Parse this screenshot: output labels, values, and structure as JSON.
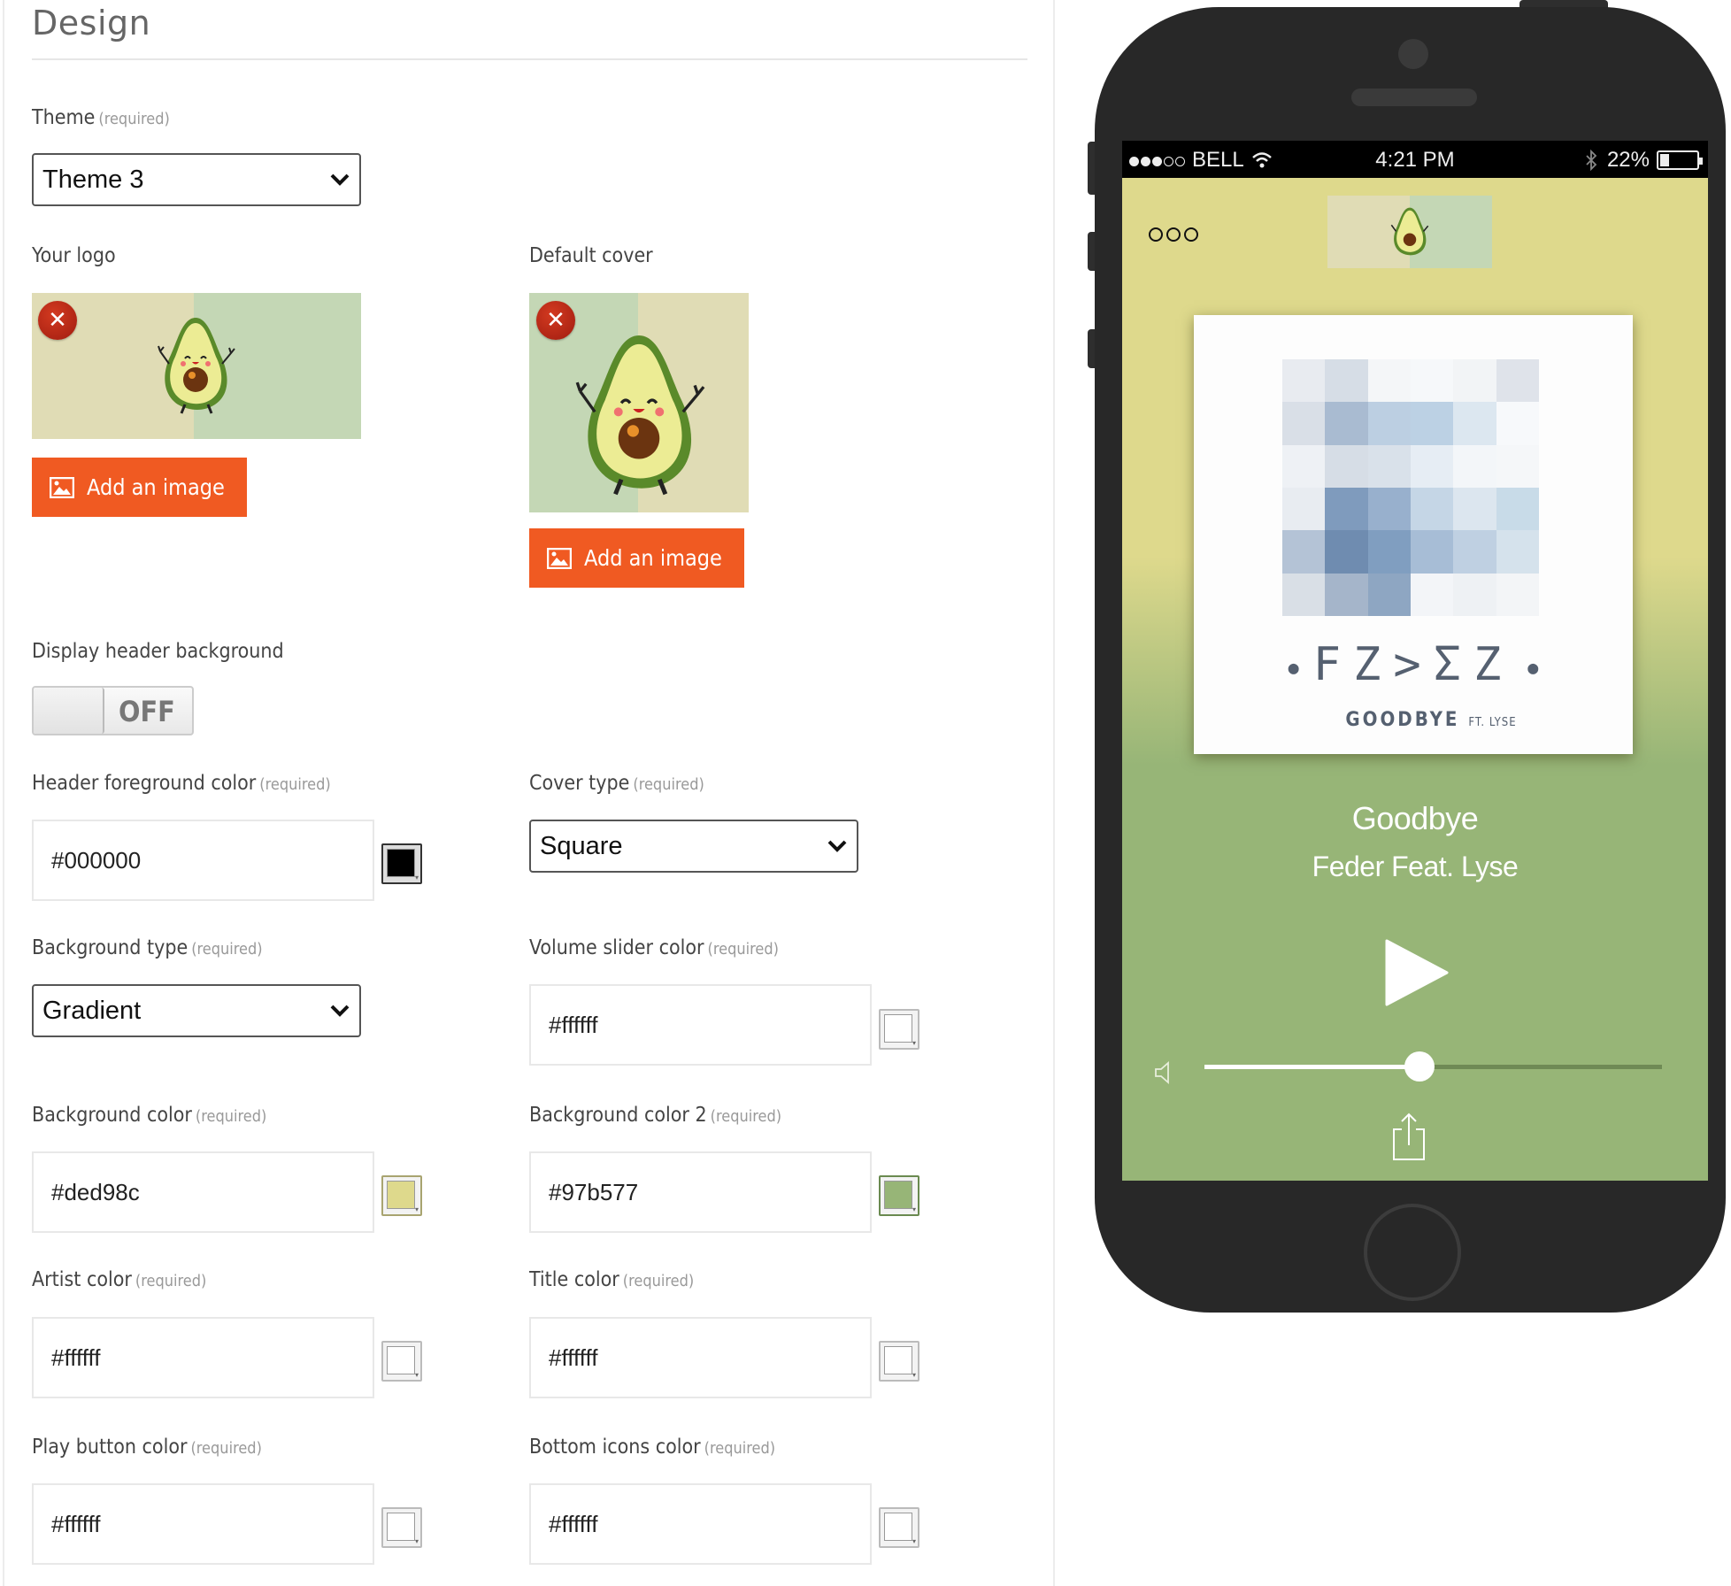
{
  "page": {
    "title": "Design"
  },
  "required_text": "(required)",
  "theme": {
    "label": "Theme",
    "value": "Theme 3"
  },
  "logo": {
    "label": "Your logo",
    "add_button": "Add an image",
    "remove_glyph": "✕",
    "colors": [
      "#e0dcb5",
      "#c4d7b5"
    ]
  },
  "default_cover": {
    "label": "Default cover",
    "add_button": "Add an image",
    "remove_glyph": "✕",
    "colors": [
      "#c4d7b5",
      "#e0dcb5"
    ]
  },
  "header_background": {
    "label": "Display header background",
    "state": "OFF"
  },
  "fields": {
    "header_fg": {
      "label": "Header foreground color",
      "value": "#000000",
      "swatch": "#000000"
    },
    "cover_type": {
      "label": "Cover type",
      "value": "Square"
    },
    "background_type": {
      "label": "Background type",
      "value": "Gradient"
    },
    "volume_slider": {
      "label": "Volume slider color",
      "value": "#ffffff",
      "swatch": "#ffffff"
    },
    "background_color": {
      "label": "Background color",
      "value": "#ded98c",
      "swatch": "#ded98c"
    },
    "background_color2": {
      "label": "Background color 2",
      "value": "#97b577",
      "swatch": "#97b577"
    },
    "artist_color": {
      "label": "Artist color",
      "value": "#ffffff",
      "swatch": "#ffffff"
    },
    "title_color": {
      "label": "Title color",
      "value": "#ffffff",
      "swatch": "#ffffff"
    },
    "play_button": {
      "label": "Play button color",
      "value": "#ffffff",
      "swatch": "#ffffff"
    },
    "bottom_icons": {
      "label": "Bottom icons color",
      "value": "#ffffff",
      "swatch": "#ffffff"
    }
  },
  "phone": {
    "status": {
      "signal_full": 3,
      "signal_total": 5,
      "carrier": "BELL",
      "time": "4:21 PM",
      "battery": "22%",
      "battery_level": 0.22
    },
    "cover": {
      "band": "FZ>ΣZ",
      "track": "GOODBYE",
      "feat": "FT. LYSE"
    },
    "song_title": "Goodbye",
    "song_artist": "Feder Feat. Lyse",
    "volume": 0.47
  },
  "accent": "#f05a22"
}
